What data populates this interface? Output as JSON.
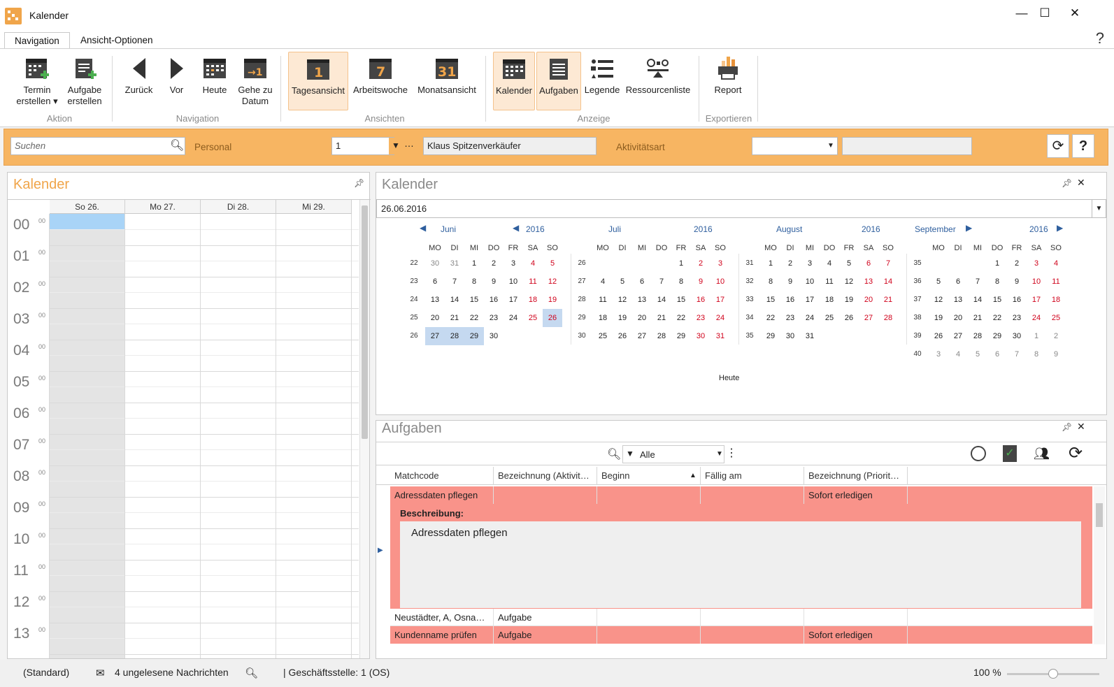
{
  "window": {
    "title": "Kalender",
    "minimize": "—",
    "maximize": "☐",
    "close": "✕"
  },
  "tabs": {
    "navigation": "Navigation",
    "options": "Ansicht-Optionen",
    "help": "?"
  },
  "ribbon": {
    "termin": "Termin erstellen ▾",
    "aufgabe": "Aufgabe erstellen",
    "zurueck": "Zurück",
    "vor": "Vor",
    "heute": "Heute",
    "gehe": "Gehe zu Datum",
    "tagesansicht": "Tagesansicht",
    "arbeitswoche": "Arbeitswoche",
    "monatsansicht": "Monatsansicht",
    "kalender": "Kalender",
    "aufgaben": "Aufgaben",
    "legende": "Legende",
    "ressourcen": "Ressourcenliste",
    "report": "Report",
    "icon_day": "1",
    "icon_week": "7",
    "icon_month": "31",
    "groups": {
      "aktion": "Aktion",
      "navigation": "Navigation",
      "ansichten": "Ansichten",
      "anzeige": "Anzeige",
      "exportieren": "Exportieren"
    }
  },
  "filter": {
    "search_placeholder": "Suchen",
    "personal_label": "Personal",
    "personal_value": "1",
    "personal_name": "Klaus Spitzenverkäufer",
    "aktivitaet_label": "Aktivitätsart",
    "aktivitaet_value": "",
    "aktivitaet_desc": ""
  },
  "left_calendar": {
    "title": "Kalender",
    "days": [
      "So 26.",
      "Mo 27.",
      "Di 28.",
      "Mi 29."
    ],
    "hours": [
      "00",
      "01",
      "02",
      "03",
      "04",
      "05",
      "06",
      "07",
      "08",
      "09",
      "10",
      "11",
      "12",
      "13"
    ],
    "minute_label": "00"
  },
  "right_calendar": {
    "title": "Kalender",
    "date_value": "26.06.2016",
    "weekdays": [
      "MO",
      "DI",
      "MI",
      "DO",
      "FR",
      "SA",
      "SO"
    ],
    "today_label": "Heute",
    "months": [
      {
        "name": "Juni",
        "year": "2016",
        "weeks": [
          "22",
          "23",
          "24",
          "25",
          "26"
        ],
        "days": [
          [
            "30",
            "31",
            "1",
            "2",
            "3",
            "4",
            "5"
          ],
          [
            "6",
            "7",
            "8",
            "9",
            "10",
            "11",
            "12"
          ],
          [
            "13",
            "14",
            "15",
            "16",
            "17",
            "18",
            "19"
          ],
          [
            "20",
            "21",
            "22",
            "23",
            "24",
            "25",
            "26"
          ],
          [
            "27",
            "28",
            "29",
            "30",
            "",
            "",
            ""
          ]
        ]
      },
      {
        "name": "Juli",
        "year": "2016",
        "weeks": [
          "26",
          "27",
          "28",
          "29",
          "30"
        ],
        "days": [
          [
            "",
            "",
            "",
            "",
            "1",
            "2",
            "3"
          ],
          [
            "4",
            "5",
            "6",
            "7",
            "8",
            "9",
            "10"
          ],
          [
            "11",
            "12",
            "13",
            "14",
            "15",
            "16",
            "17"
          ],
          [
            "18",
            "19",
            "20",
            "21",
            "22",
            "23",
            "24"
          ],
          [
            "25",
            "26",
            "27",
            "28",
            "29",
            "30",
            "31"
          ]
        ]
      },
      {
        "name": "August",
        "year": "2016",
        "weeks": [
          "31",
          "32",
          "33",
          "34",
          "35"
        ],
        "days": [
          [
            "1",
            "2",
            "3",
            "4",
            "5",
            "6",
            "7"
          ],
          [
            "8",
            "9",
            "10",
            "11",
            "12",
            "13",
            "14"
          ],
          [
            "15",
            "16",
            "17",
            "18",
            "19",
            "20",
            "21"
          ],
          [
            "22",
            "23",
            "24",
            "25",
            "26",
            "27",
            "28"
          ],
          [
            "29",
            "30",
            "31",
            "",
            "",
            "",
            ""
          ]
        ]
      },
      {
        "name": "September",
        "year": "2016",
        "weeks": [
          "35",
          "36",
          "37",
          "38",
          "39",
          "40"
        ],
        "days": [
          [
            "",
            "",
            "",
            "1",
            "2",
            "3",
            "4"
          ],
          [
            "5",
            "6",
            "7",
            "8",
            "9",
            "10",
            "11"
          ],
          [
            "12",
            "13",
            "14",
            "15",
            "16",
            "17",
            "18"
          ],
          [
            "19",
            "20",
            "21",
            "22",
            "23",
            "24",
            "25"
          ],
          [
            "26",
            "27",
            "28",
            "29",
            "30",
            "1",
            "2"
          ],
          [
            "3",
            "4",
            "5",
            "6",
            "7",
            "8",
            "9"
          ]
        ]
      }
    ]
  },
  "tasks": {
    "title": "Aufgaben",
    "filter_value": "Alle",
    "columns": [
      "Matchcode",
      "Bezeichnung (Aktivit…",
      "Beginn",
      "Fällig am",
      "Bezeichnung (Priorit…"
    ],
    "rows": [
      {
        "matchcode": "Adressdaten pflegen",
        "bez": "",
        "beginn": "",
        "faellig": "",
        "prio": "Sofort erledigen",
        "color": "#f9938a"
      },
      {
        "matchcode": "Neustädter, A, Osna…",
        "bez": "Aufgabe",
        "beginn": "",
        "faellig": "",
        "prio": "",
        "color": "#ffffff"
      },
      {
        "matchcode": "Kundenname prüfen",
        "bez": "Aufgabe",
        "beginn": "",
        "faellig": "",
        "prio": "Sofort erledigen",
        "color": "#f9938a"
      }
    ],
    "desc_label": "Beschreibung:",
    "desc_text": "Adressdaten pflegen"
  },
  "status": {
    "layout": "(Standard)",
    "messages": "4 ungelesene Nachrichten",
    "branch": "| Geschäftsstelle:  1 (OS)",
    "zoom": "100 %",
    "zoom_level": 0.5
  },
  "colors": {
    "accent": "#f7b562",
    "selection": "#a9d4f7",
    "row_red": "#f9938a"
  }
}
